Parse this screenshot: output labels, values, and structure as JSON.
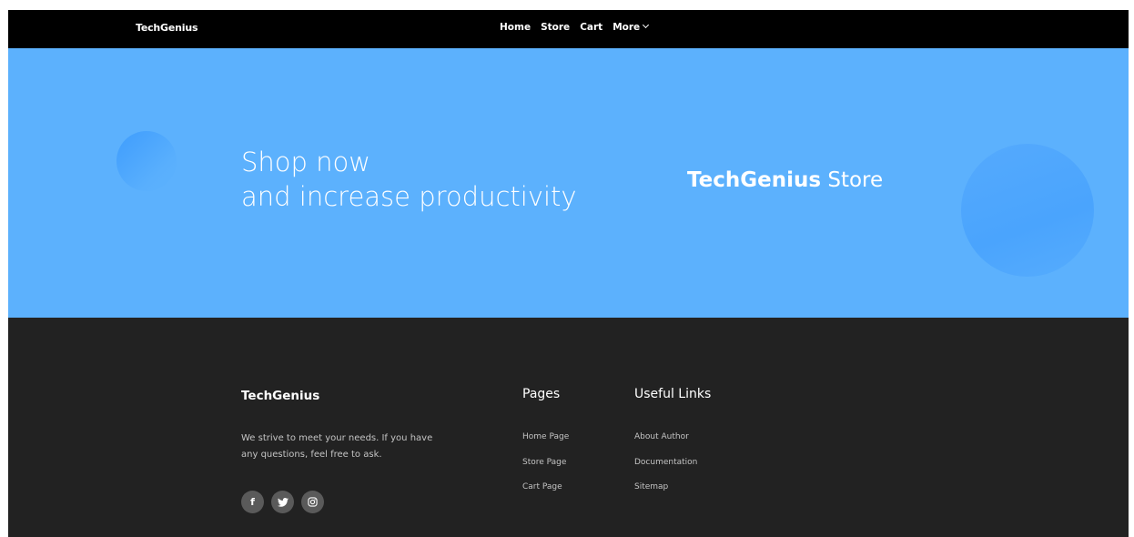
{
  "navbar": {
    "brand": "TechGenius",
    "links": [
      {
        "label": "Home"
      },
      {
        "label": "Store"
      },
      {
        "label": "Cart"
      },
      {
        "label": "More"
      }
    ]
  },
  "hero": {
    "line1": "Shop now",
    "line2": "and increase productivity",
    "store_bold": "TechGenius",
    "store_rest": " Store",
    "background_color": "#5cb1fd"
  },
  "footer": {
    "brand": "TechGenius",
    "description": "We strive to meet your needs. If you have any questions, feel free to ask.",
    "socials": [
      {
        "icon": "facebook-icon",
        "glyph": "f"
      },
      {
        "icon": "twitter-icon",
        "glyph": "🐦"
      },
      {
        "icon": "instagram-icon",
        "glyph": "◎"
      }
    ],
    "pages": {
      "title": "Pages",
      "links": [
        "Home Page",
        "Store Page",
        "Cart Page"
      ]
    },
    "useful": {
      "title": "Useful Links",
      "links": [
        "About Author",
        "Documentation",
        "Sitemap"
      ]
    },
    "background_color": "#222222"
  }
}
